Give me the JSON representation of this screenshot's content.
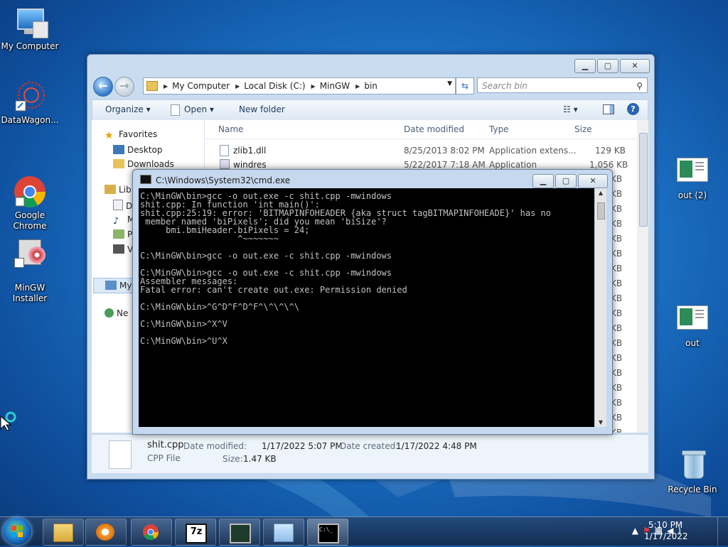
{
  "desktop": {
    "icons": [
      {
        "label": "My Computer"
      },
      {
        "label": "DataWagon..."
      },
      {
        "label": "Google\nChrome"
      },
      {
        "label": "MinGW\nInstaller"
      },
      {
        "label": "out (2)"
      },
      {
        "label": "out"
      },
      {
        "label": "Recycle Bin"
      }
    ]
  },
  "explorer": {
    "address": [
      "My Computer",
      "Local Disk (C:)",
      "MinGW",
      "bin"
    ],
    "search_placeholder": "Search bin",
    "toolbar": {
      "organize": "Organize ▾",
      "open": "Open  ▾",
      "new_folder": "New folder"
    },
    "nav": {
      "favorites": "Favorites",
      "desktop": "Desktop",
      "downloads": "Downloads",
      "libraries": "Lib",
      "lib_d": "D",
      "lib_m": "M",
      "lib_p": "P",
      "lib_v": "V",
      "computer": "My",
      "network": "Ne"
    },
    "columns": {
      "name": "Name",
      "date": "Date modified",
      "type": "Type",
      "size": "Size"
    },
    "files": [
      {
        "name": "zlib1.dll",
        "date": "8/25/2013 8:02 PM",
        "type": "Application extens...",
        "size": "129 KB"
      },
      {
        "name": "windres",
        "date": "5/22/2017 7:18 AM",
        "type": "Application",
        "size": "1,056 KB"
      }
    ],
    "right_size_fragments": [
      "KB",
      "KB",
      "KB",
      "KB",
      "KB",
      "KB",
      "KB",
      "KB",
      "KB",
      "KB",
      "KB",
      "KB",
      "KB",
      "KB",
      "KB",
      "KB",
      "KB",
      "KB"
    ],
    "details": {
      "name": "shit.cpp",
      "type": "CPP File",
      "modified_label": "Date modified:",
      "modified": "1/17/2022 5:07 PM",
      "size_label": "Size:",
      "size": "1.47 KB",
      "created_label": "Date created:",
      "created": "1/17/2022 4:48 PM"
    }
  },
  "cmd": {
    "title": "C:\\Windows\\System32\\cmd.exe",
    "output": "C:\\MinGW\\bin>gcc -o out.exe -c shit.cpp -mwindows\nshit.cpp: In function 'int main()':\nshit.cpp:25:19: error: 'BITMAPINFOHEADER {aka struct tagBITMAPINFOHEADE}' has no\n member named 'biPixels'; did you mean 'biSize'?\n     bmi.bmiHeader.biPixels = 24;\n                   ^~~~~~~~\n\nC:\\MinGW\\bin>gcc -o out.exe -c shit.cpp -mwindows\n\nC:\\MinGW\\bin>gcc -o out.exe -c shit.cpp -mwindows\nAssembler messages:\nFatal error: can't create out.exe: Permission denied\n\nC:\\MinGW\\bin>^G^D^F^D^F^\\^\\^\\^\\\n\nC:\\MinGW\\bin>^X^V\n\nC:\\MinGW\\bin>^U^X"
  },
  "taskbar": {
    "time": "5:10 PM",
    "date": "1/17/2022"
  }
}
